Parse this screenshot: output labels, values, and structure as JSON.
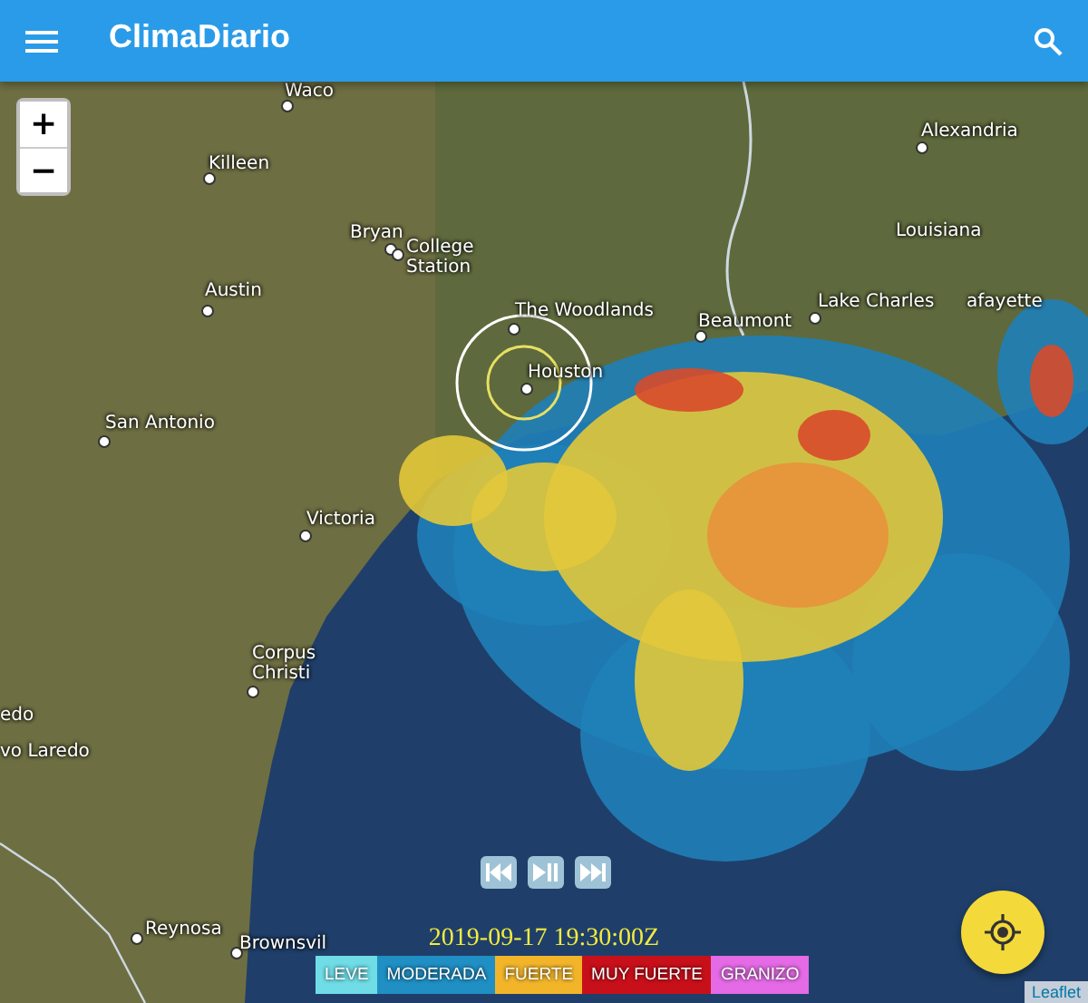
{
  "app_bar": {
    "title": "ClimaDiario"
  },
  "map": {
    "zoom_controls": [
      "+",
      "−"
    ],
    "places": [
      {
        "name": "Waco",
        "dot": true
      },
      {
        "name": "Killeen",
        "dot": true
      },
      {
        "name": "Alexandria",
        "dot": true
      },
      {
        "name": "Bryan",
        "dot": true
      },
      {
        "name": "College Station",
        "dot": true
      },
      {
        "name": "Austin",
        "dot": true
      },
      {
        "name": "Louisiana",
        "dot": false
      },
      {
        "name": "The Woodlands",
        "dot": true
      },
      {
        "name": "Beaumont",
        "dot": true
      },
      {
        "name": "Lake Charles",
        "dot": true
      },
      {
        "name": "afayette",
        "dot": false
      },
      {
        "name": "Houston",
        "dot": true
      },
      {
        "name": "San Antonio",
        "dot": true
      },
      {
        "name": "Victoria",
        "dot": true
      },
      {
        "name": "Corpus Christi",
        "dot": true
      },
      {
        "name": "edo",
        "dot": false
      },
      {
        "name": "vo Laredo",
        "dot": false
      },
      {
        "name": "Reynosa",
        "dot": true
      },
      {
        "name": "Brownsvil",
        "dot": true
      }
    ],
    "timestamp": "2019-09-17 19:30:00Z",
    "legend": [
      {
        "label": "LEVE",
        "color": "#6fdce6"
      },
      {
        "label": "MODERADA",
        "color": "#1f8fc4"
      },
      {
        "label": "FUERTE",
        "color": "#f2b52a"
      },
      {
        "label": "MUY FUERTE",
        "color": "#c8101a"
      },
      {
        "label": "GRANIZO",
        "color": "#e46ae6"
      }
    ],
    "attribution": "Leaflet"
  }
}
